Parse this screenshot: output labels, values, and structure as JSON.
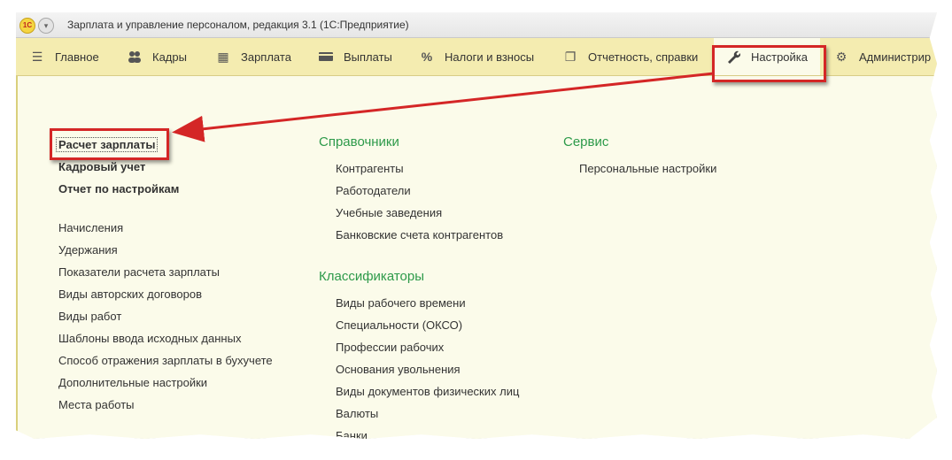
{
  "window": {
    "title": "Зарплата и управление персоналом, редакция 3.1  (1С:Предприятие)",
    "logo_text": "1С"
  },
  "sections": [
    {
      "label": "Главное",
      "icon": "hamburger-icon"
    },
    {
      "label": "Кадры",
      "icon": "people-icon"
    },
    {
      "label": "Зарплата",
      "icon": "calculator-icon"
    },
    {
      "label": "Выплаты",
      "icon": "wallet-icon"
    },
    {
      "label": "Налоги и взносы",
      "icon": "percent-icon"
    },
    {
      "label": "Отчетность, справки",
      "icon": "reports-icon"
    },
    {
      "label": "Настройка",
      "icon": "wrench-icon",
      "active": true
    },
    {
      "label": "Администрир",
      "icon": "gear-icon"
    }
  ],
  "main_links": {
    "bold": [
      "Расчет зарплаты",
      "Кадровый учет",
      "Отчет по настройкам"
    ],
    "items": [
      "Начисления",
      "Удержания",
      "Показатели расчета зарплаты",
      "Виды авторских договоров",
      "Виды работ",
      "Шаблоны ввода исходных данных",
      "Способ отражения зарплаты в бухучете",
      "Дополнительные настройки",
      "Места работы"
    ]
  },
  "directories": {
    "title": "Справочники",
    "items": [
      "Контрагенты",
      "Работодатели",
      "Учебные заведения",
      "Банковские счета контрагентов"
    ]
  },
  "classifiers": {
    "title": "Классификаторы",
    "items": [
      "Виды рабочего времени",
      "Специальности (ОКСО)",
      "Профессии рабочих",
      "Основания увольнения",
      "Виды документов физических лиц",
      "Валюты",
      "Банки"
    ]
  },
  "service": {
    "title": "Сервис",
    "items": [
      "Персональные настройки"
    ]
  },
  "colors": {
    "section_bar": "#f4ecb0",
    "content_bg": "#fbfbea",
    "group_title": "#2d9a4a",
    "annotation": "#d42626"
  }
}
